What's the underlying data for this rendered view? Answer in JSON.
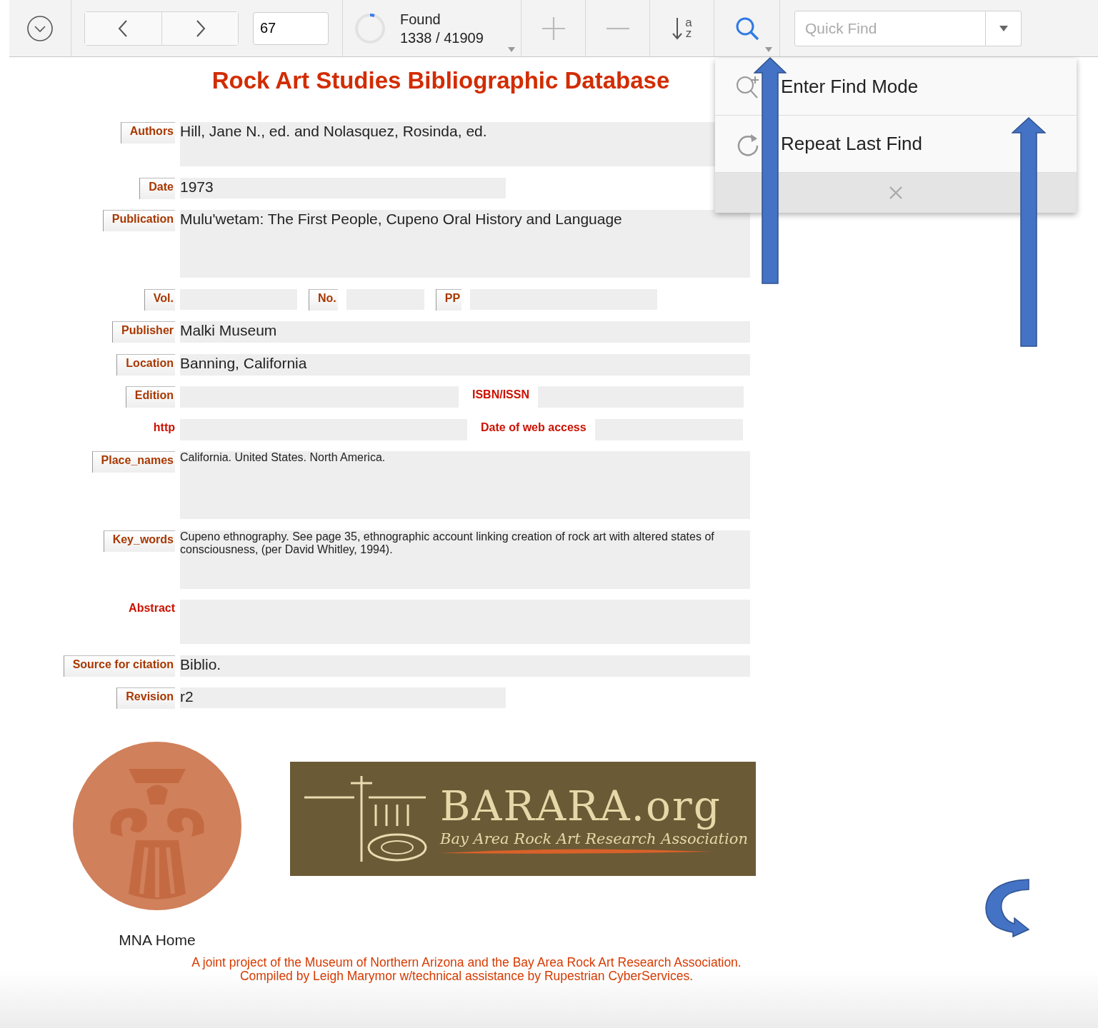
{
  "toolbar": {
    "record_number": "67",
    "found_label": "Found",
    "found_count": "1338 / 41909",
    "quick_find": {
      "placeholder": "Quick Find"
    },
    "find_menu_expanded": true,
    "sort_letters": [
      "a",
      "z"
    ]
  },
  "find_menu": {
    "items": [
      {
        "kind": "find",
        "label": "Enter Find Mode"
      },
      {
        "kind": "repeat",
        "label": "Repeat Last Find"
      }
    ]
  },
  "title": "Rock Art Studies Bibliographic Database",
  "form": {
    "rows": [
      {
        "kind": "tall",
        "items": [
          {
            "label": "Authors",
            "boxed": true,
            "value": "Hill, Jane N., ed. and Nolasquez, Rosinda, ed."
          }
        ]
      },
      {
        "kind": "short",
        "items": [
          {
            "label": "Date",
            "boxed": true,
            "value": "1973"
          }
        ]
      },
      {
        "kind": "taller",
        "items": [
          {
            "label": "Publication",
            "boxed": true,
            "value": "Mulu'wetam: The First People, Cupeno Oral History and Language"
          }
        ]
      },
      {
        "kind": "triple",
        "items": [
          {
            "label": "Vol.",
            "boxed": true
          },
          {
            "label": "No.",
            "boxed": true
          },
          {
            "label": "PP",
            "boxed": true
          }
        ]
      },
      {
        "kind": "full",
        "items": [
          {
            "label": "Publisher",
            "boxed": true,
            "value": "Malki Museum"
          }
        ]
      },
      {
        "kind": "full",
        "items": [
          {
            "label": "Location",
            "boxed": true,
            "value": "Banning, California"
          }
        ]
      },
      {
        "kind": "pair",
        "items": [
          {
            "label": "Edition",
            "boxed": true
          },
          {
            "label": "ISBN/ISSN",
            "boxed": false
          }
        ]
      },
      {
        "kind": "pair-wide",
        "items": [
          {
            "label": "http",
            "boxed": false
          },
          {
            "label": "Date of web access",
            "boxed": false
          }
        ]
      },
      {
        "kind": "taller-small",
        "items": [
          {
            "label": "Place_names",
            "boxed": true,
            "value": "California. United States. North America."
          }
        ]
      },
      {
        "kind": "tall-small",
        "items": [
          {
            "label": "Key_words",
            "boxed": true,
            "value": "Cupeno ethnography. See page 35, ethnographic account linking creation of rock art with altered states of consciousness, (per David Whitley, 1994)."
          }
        ]
      },
      {
        "kind": "tall",
        "items": [
          {
            "label": "Abstract",
            "boxed": false
          }
        ]
      },
      {
        "kind": "full",
        "items": [
          {
            "label": "Source for citation",
            "boxed": true,
            "value": "Biblio."
          }
        ]
      },
      {
        "kind": "short",
        "items": [
          {
            "label": "Revision",
            "boxed": true,
            "value": "r2"
          }
        ]
      }
    ]
  },
  "footer": {
    "mna_link": "MNA Home",
    "barara_logo": {
      "name": "BARARA.org",
      "tagline": "Bay Area Rock Art Research Association"
    },
    "credits": [
      "A joint project of the Museum of Northern Arizona and the Bay Area Rock Art Research Association.",
      "Compiled by Leigh Marymor w/technical assistance by Rupestrian CyberServices."
    ]
  }
}
